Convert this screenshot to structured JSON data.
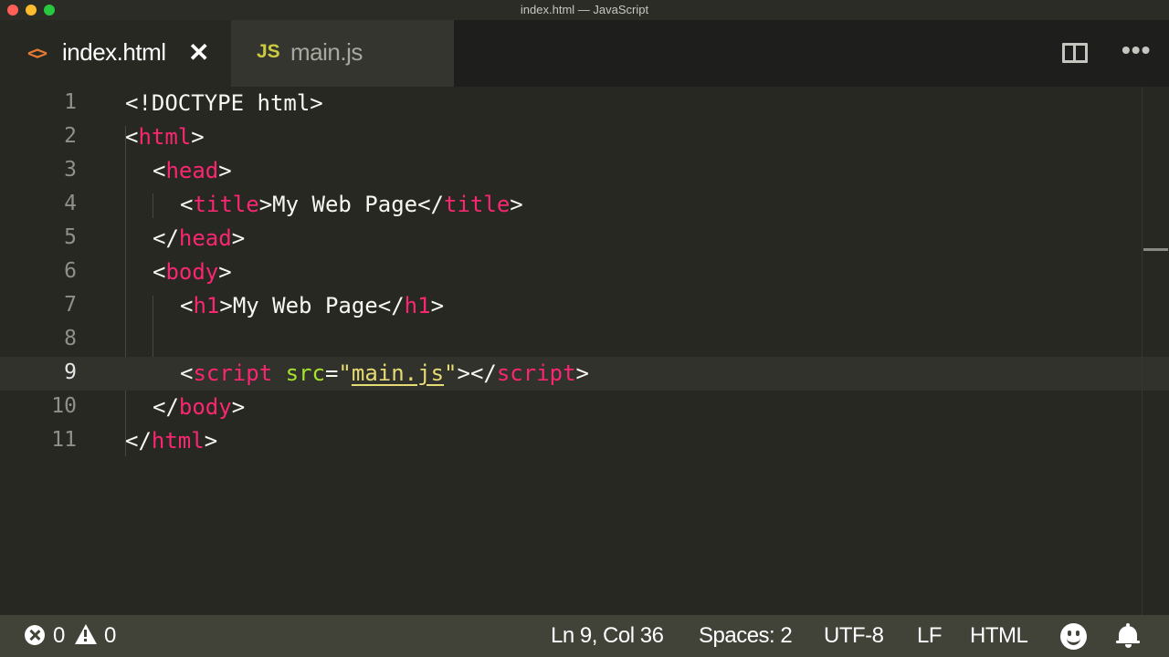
{
  "window": {
    "title": "index.html — JavaScript"
  },
  "tabs": [
    {
      "label": "index.html",
      "icon": "html-file-icon",
      "active": true,
      "close": "✕"
    },
    {
      "label": "main.js",
      "icon": "js-file-icon",
      "active": false,
      "icon_text": "JS"
    }
  ],
  "tab_actions": {
    "split": "split-editor-icon",
    "more": "•••"
  },
  "editor": {
    "current_line": 9,
    "lines": [
      {
        "n": "1"
      },
      {
        "n": "2"
      },
      {
        "n": "3"
      },
      {
        "n": "4"
      },
      {
        "n": "5"
      },
      {
        "n": "6"
      },
      {
        "n": "7"
      },
      {
        "n": "8"
      },
      {
        "n": "9"
      },
      {
        "n": "10"
      },
      {
        "n": "11"
      }
    ],
    "code": {
      "l1": {
        "a": "<!DOCTYPE html>"
      },
      "l2": {
        "open": "<",
        "tag": "html",
        "close": ">"
      },
      "l3": {
        "open": "<",
        "tag": "head",
        "close": ">"
      },
      "l4": {
        "open": "<",
        "tag": "title",
        "close": ">",
        "text": "My Web Page",
        "open2": "</",
        "tag2": "title",
        "close2": ">"
      },
      "l5": {
        "open": "</",
        "tag": "head",
        "close": ">"
      },
      "l6": {
        "open": "<",
        "tag": "body",
        "close": ">"
      },
      "l7": {
        "open": "<",
        "tag": "h1",
        "close": ">",
        "text": "My Web Page",
        "open2": "</",
        "tag2": "h1",
        "close2": ">"
      },
      "l9": {
        "open": "<",
        "tag": "script",
        "space": " ",
        "attr": "src",
        "eq": "=",
        "q1": "\"",
        "val": "main.js",
        "q2": "\"",
        "close": ">",
        "open2": "</",
        "tag2": "script",
        "close2": ">"
      },
      "l10": {
        "open": "</",
        "tag": "body",
        "close": ">"
      },
      "l11": {
        "open": "</",
        "tag": "html",
        "close": ">"
      }
    }
  },
  "status": {
    "errors": "0",
    "warnings": "0",
    "position": "Ln 9, Col 36",
    "spaces": "Spaces: 2",
    "encoding": "UTF-8",
    "eol": "LF",
    "language": "HTML"
  }
}
